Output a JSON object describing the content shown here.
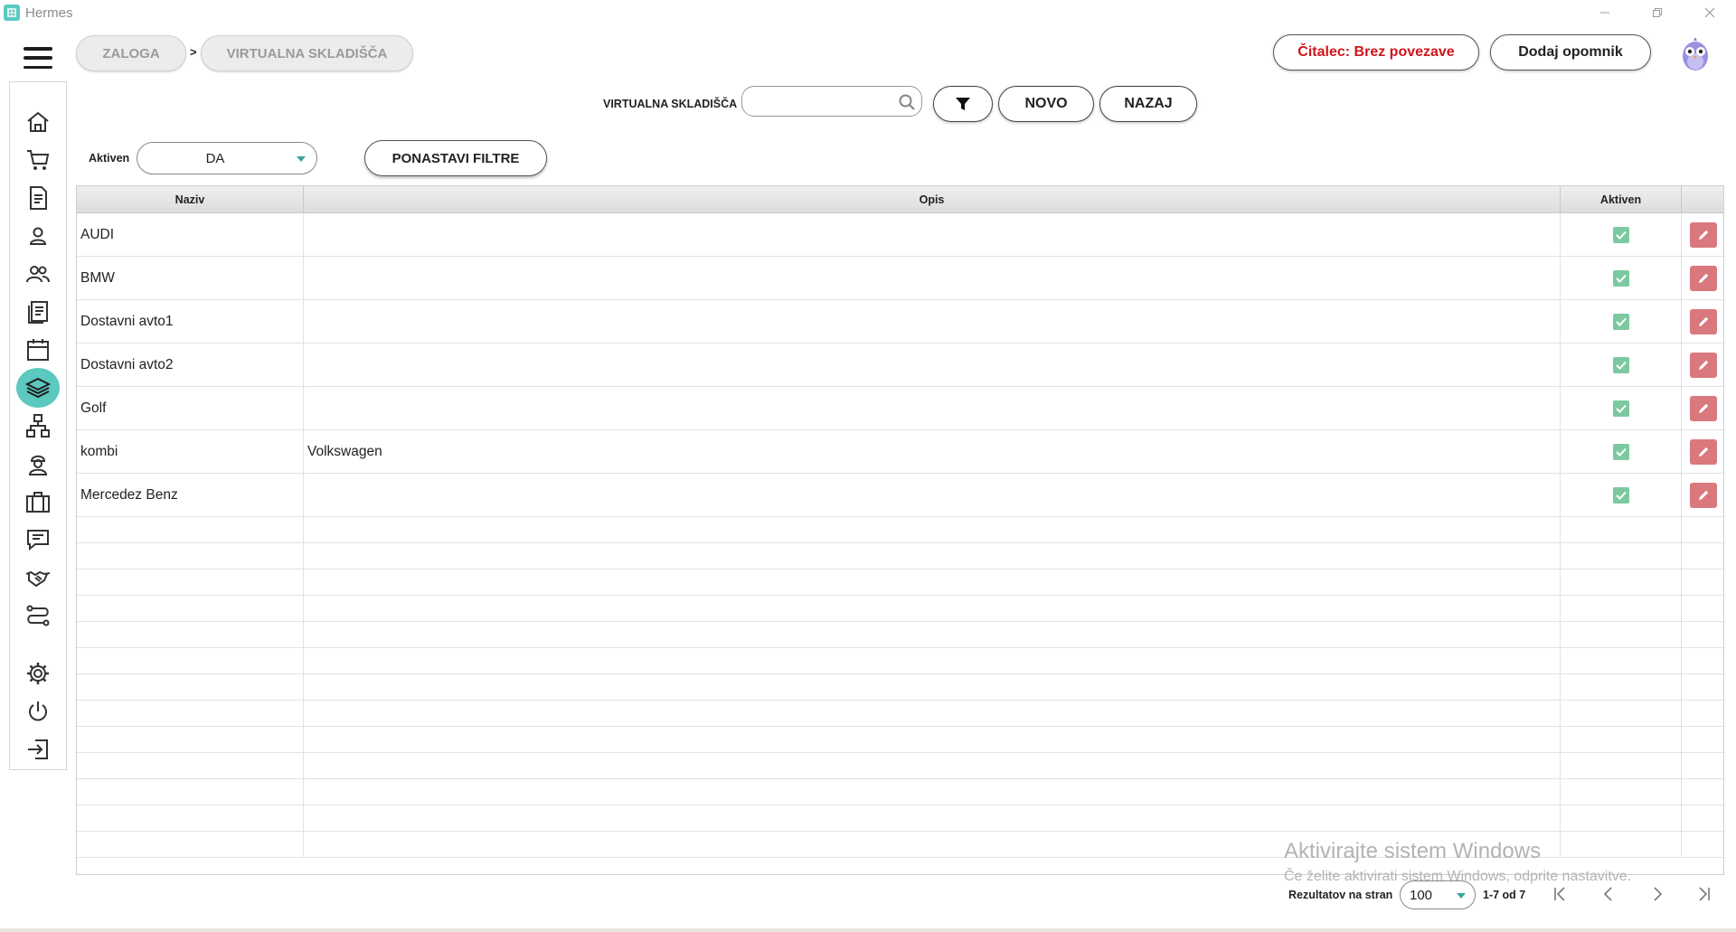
{
  "window": {
    "title": "Hermes",
    "controls": [
      "minimize",
      "restore",
      "close"
    ]
  },
  "breadcrumb": {
    "items": [
      "ZALOGA",
      "VIRTUALNA SKLADIŠČA"
    ],
    "separator": ">"
  },
  "header": {
    "reader_status": "Čitalec: Brez povezave",
    "add_reminder": "Dodaj opomnik",
    "reader_color": "#d0141c"
  },
  "sidebar": {
    "accent": "#5cc9c0",
    "items": [
      {
        "icon": "home-icon",
        "active": false
      },
      {
        "icon": "cart-icon",
        "active": false
      },
      {
        "icon": "document-icon",
        "active": false
      },
      {
        "icon": "person-icon",
        "active": false
      },
      {
        "icon": "people-icon",
        "active": false
      },
      {
        "icon": "news-icon",
        "active": false
      },
      {
        "icon": "calendar-icon",
        "active": false
      },
      {
        "icon": "layers-icon",
        "active": true
      },
      {
        "icon": "network-icon",
        "active": false
      },
      {
        "icon": "worker-icon",
        "active": false
      },
      {
        "icon": "briefcase-icon",
        "active": false
      },
      {
        "icon": "chat-icon",
        "active": false
      },
      {
        "icon": "handshake-icon",
        "active": false
      },
      {
        "icon": "route-icon",
        "active": false
      },
      {
        "icon": "gear-icon",
        "active": false
      },
      {
        "icon": "power-icon",
        "active": false
      },
      {
        "icon": "logout-icon",
        "active": false
      }
    ]
  },
  "search": {
    "label": "VIRTUALNA SKLADIŠČA",
    "value": "",
    "placeholder": ""
  },
  "actions": {
    "new": "NOVO",
    "back": "NAZAJ"
  },
  "filter": {
    "label": "Aktiven",
    "value": "DA",
    "reset": "PONASTAVI FILTRE"
  },
  "table": {
    "columns": [
      "Naziv",
      "Opis",
      "Aktiven",
      ""
    ],
    "rows": [
      {
        "naziv": "AUDI",
        "opis": "",
        "aktiven": true
      },
      {
        "naziv": "BMW",
        "opis": "",
        "aktiven": true
      },
      {
        "naziv": "Dostavni avto1",
        "opis": "",
        "aktiven": true
      },
      {
        "naziv": "Dostavni avto2",
        "opis": "",
        "aktiven": true
      },
      {
        "naziv": "Golf",
        "opis": "",
        "aktiven": true
      },
      {
        "naziv": "kombi",
        "opis": "Volkswagen",
        "aktiven": true
      },
      {
        "naziv": "Mercedez Benz",
        "opis": "",
        "aktiven": true
      }
    ],
    "check_color": "#7cc9a0",
    "edit_color": "#d9787d"
  },
  "watermark": {
    "line1": "Aktivirajte sistem Windows",
    "line2": "Če želite aktivirati sistem Windows, odprite nastavitve."
  },
  "pagination": {
    "label": "Rezultatov na stran",
    "per_page": "100",
    "count": "1-7 od 7"
  }
}
